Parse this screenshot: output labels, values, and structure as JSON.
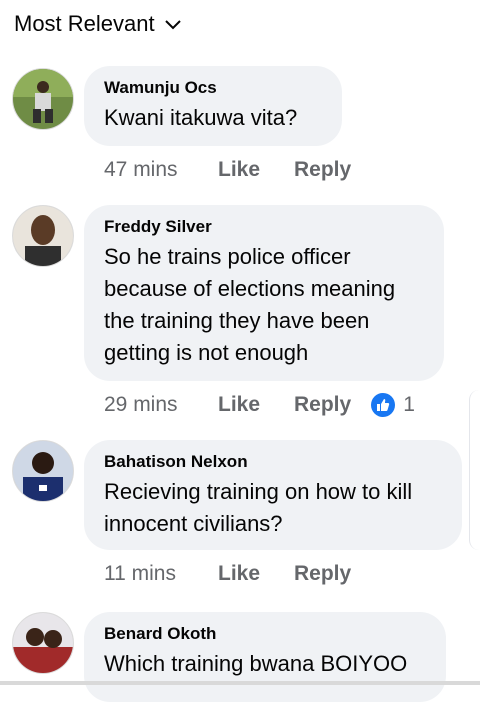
{
  "sort": {
    "label": "Most Relevant"
  },
  "comments": [
    {
      "author": "Wamunju Ocs",
      "text": "Kwani itakuwa vita?",
      "time": "47 mins",
      "like": "Like",
      "reply": "Reply"
    },
    {
      "author": "Freddy Silver",
      "text": "So he trains police officer because of elections meaning the training they have been getting is not enough",
      "time": "29 mins",
      "like": "Like",
      "reply": "Reply",
      "reaction_count": "1"
    },
    {
      "author": "Bahatison Nelxon",
      "text": "Recieving training on how to kill innocent civilians?",
      "time": "11 mins",
      "like": "Like",
      "reply": "Reply"
    },
    {
      "author": "Benard Okoth",
      "text": "Which training bwana BOIYOO"
    }
  ],
  "colors": {
    "bubble": "#f0f2f5",
    "meta_text": "#65676b",
    "like_reaction": "#1877f2"
  },
  "icons": [
    "chevron-down-icon",
    "thumbs-up-icon"
  ]
}
